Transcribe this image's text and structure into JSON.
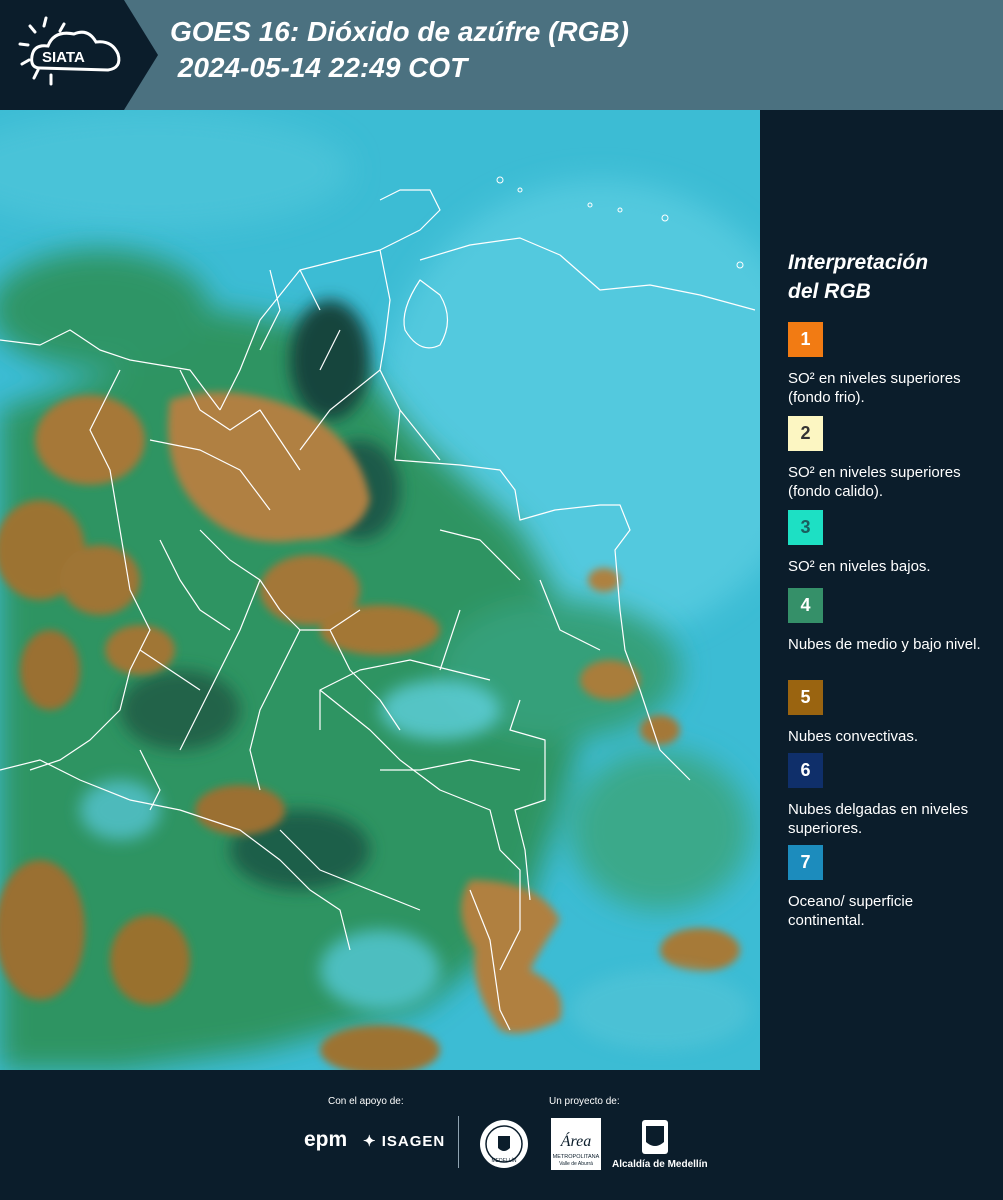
{
  "header": {
    "logo_text": "SIATA",
    "title_line1": "GOES 16: Dióxido de azúfre (RGB)",
    "title_line2": " 2024-05-14 22:49 COT",
    "background_color": "#4b7180",
    "logo_background_color": "#0b1d2b"
  },
  "map": {
    "description_colors": {
      "ocean_surface": "#39b8cf",
      "convective_clouds": "#a77a3a",
      "mid_low_clouds": "#2f8f5a",
      "thin_high_clouds": "#123d3a",
      "borders": "#ffffff"
    }
  },
  "legend": {
    "title_line1": "Interpretación",
    "title_line2": "del RGB",
    "items": [
      {
        "number": "1",
        "color": "#f27b13",
        "number_color": "#ffffff",
        "text": "SO² en niveles superiores (fondo frio)."
      },
      {
        "number": "2",
        "color": "#fcf6c2",
        "number_color": "#333333",
        "text": "SO² en niveles superiores (fondo calido)."
      },
      {
        "number": "3",
        "color": "#1de0c4",
        "number_color": "#1a5f5f",
        "text": "SO² en niveles bajos."
      },
      {
        "number": "4",
        "color": "#359069",
        "number_color": "#ffffff",
        "text": "Nubes de medio y bajo nivel."
      },
      {
        "number": "5",
        "color": "#9a6410",
        "number_color": "#ffffff",
        "text": "Nubes convectivas."
      },
      {
        "number": "6",
        "color": "#0f2f6a",
        "number_color": "#ffffff",
        "text": "Nubes delgadas en niveles superiores."
      },
      {
        "number": "7",
        "color": "#1c8cbd",
        "number_color": "#ffffff",
        "text": "Oceano/ superficie continental."
      }
    ]
  },
  "footer": {
    "support_label": "Con el apoyo de:",
    "project_label": "Un proyecto de:",
    "epm_text": "epm",
    "isagen_text": "ISAGEN",
    "area_logo_text": "Área",
    "area_logo_subtext": "METROPOLITANA",
    "area_logo_subtext2": "Valle de Aburrá",
    "seal_text": "MEDELLÍN",
    "alcaldia_text": "Alcaldía de Medellín"
  }
}
